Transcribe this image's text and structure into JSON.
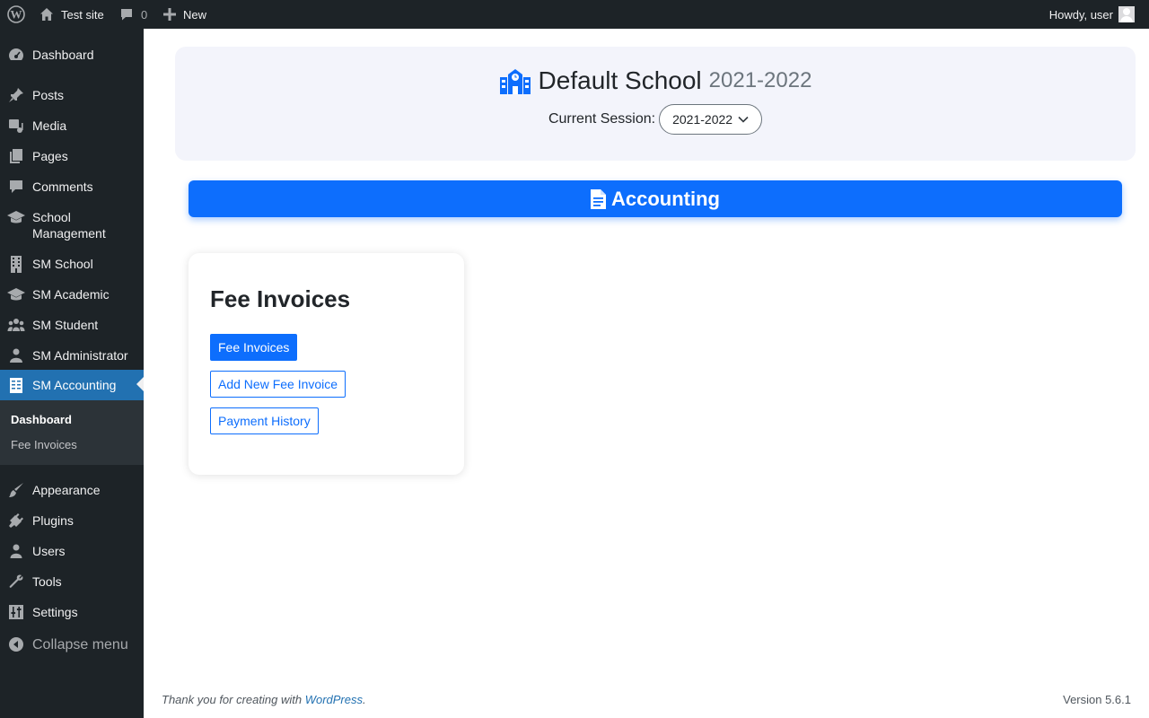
{
  "admin_bar": {
    "site_name": "Test site",
    "comments_count": "0",
    "new_label": "New",
    "howdy": "Howdy, user"
  },
  "sidebar": {
    "items": [
      {
        "label": "Dashboard",
        "icon": "dashboard-icon"
      },
      {
        "label": "Posts",
        "icon": "pin-icon"
      },
      {
        "label": "Media",
        "icon": "media-icon"
      },
      {
        "label": "Pages",
        "icon": "pages-icon"
      },
      {
        "label": "Comments",
        "icon": "comment-icon"
      },
      {
        "label": "School Management",
        "icon": "mortarboard-icon"
      },
      {
        "label": "SM School",
        "icon": "building-icon"
      },
      {
        "label": "SM Academic",
        "icon": "mortarboard-icon"
      },
      {
        "label": "SM Student",
        "icon": "groups-icon"
      },
      {
        "label": "SM Administrator",
        "icon": "businessman-icon"
      },
      {
        "label": "SM Accounting",
        "icon": "spreadsheet-icon"
      },
      {
        "label": "Appearance",
        "icon": "brush-icon"
      },
      {
        "label": "Plugins",
        "icon": "plug-icon"
      },
      {
        "label": "Users",
        "icon": "user-icon"
      },
      {
        "label": "Tools",
        "icon": "wrench-icon"
      },
      {
        "label": "Settings",
        "icon": "sliders-icon"
      }
    ],
    "submenu": [
      "Dashboard",
      "Fee Invoices"
    ],
    "collapse_label": "Collapse menu"
  },
  "school": {
    "name": "Default School",
    "year": "2021-2022",
    "session_label": "Current Session:",
    "session_value": "2021-2022"
  },
  "accounting": {
    "title": "Accounting"
  },
  "card": {
    "title": "Fee Invoices",
    "buttons": [
      "Fee Invoices",
      "Add New Fee Invoice",
      "Payment History"
    ]
  },
  "footer": {
    "thanks_prefix": "Thank you for creating with",
    "wp_link": "WordPress",
    "thanks_suffix": ".",
    "version": "Version 5.6.1"
  },
  "colors": {
    "admin_dark": "#1d2327",
    "current_menu": "#2271b1",
    "primary": "#0d6efd",
    "header_bg": "#f3f4fb"
  }
}
